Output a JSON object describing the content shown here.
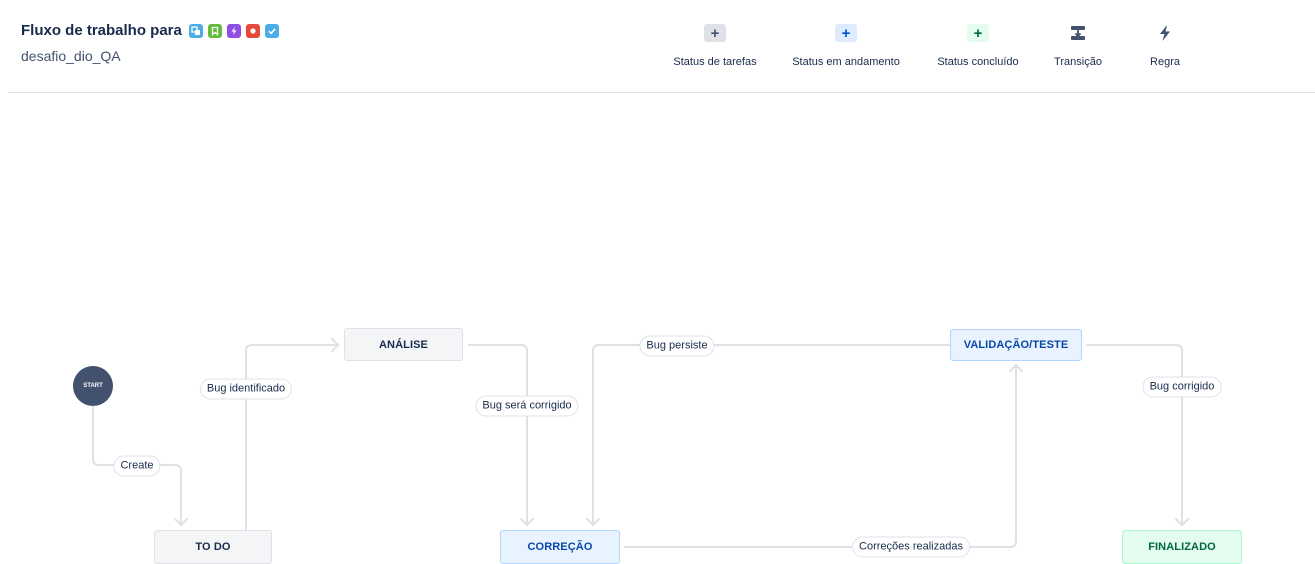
{
  "header": {
    "title": "Fluxo de trabalho para",
    "project_name": "desafio_dio_QA",
    "issue_type_icons": [
      {
        "name": "subtask-icon",
        "color": "#4bade8"
      },
      {
        "name": "story-icon",
        "color": "#63ba3c"
      },
      {
        "name": "epic-icon",
        "color": "#904ee2"
      },
      {
        "name": "bug-icon",
        "color": "#e5493a"
      },
      {
        "name": "task-icon",
        "color": "#4bade8"
      }
    ]
  },
  "toolbar": {
    "items": [
      {
        "label": "Status de tarefas",
        "icon": "plus-icon",
        "icon_color": "#42526e",
        "icon_bg": "#dfe1e6"
      },
      {
        "label": "Status em andamento",
        "icon": "plus-icon",
        "icon_color": "#0052cc",
        "icon_bg": "#deebff"
      },
      {
        "label": "Status concluído",
        "icon": "plus-icon",
        "icon_color": "#006644",
        "icon_bg": "#e3fcef"
      },
      {
        "label": "Transição",
        "icon": "transition-icon",
        "icon_color": "#42526e",
        "icon_bg": ""
      },
      {
        "label": "Regra",
        "icon": "lightning-icon",
        "icon_color": "#42526e",
        "icon_bg": ""
      }
    ]
  },
  "workflow": {
    "start_label": "START",
    "statuses": {
      "todo": "TO DO",
      "analise": "ANÁLISE",
      "correcao": "CORREÇÃO",
      "validacao": "VALIDAÇÃO/TESTE",
      "finalizado": "FINALIZADO"
    },
    "transitions": {
      "create": "Create",
      "bug_identificado": "Bug identificado",
      "bug_sera_corrigido": "Bug será corrigido",
      "bug_persiste": "Bug persiste",
      "correcoes_realizadas": "Correções realizadas",
      "bug_corrigido": "Bug corrigido"
    },
    "colors": {
      "todo_category": "#f4f5f7",
      "in_progress_category": "#e9f2ff",
      "done_category": "#e3fcef",
      "connector": "#dfe1e6",
      "start": "#42526e"
    }
  }
}
